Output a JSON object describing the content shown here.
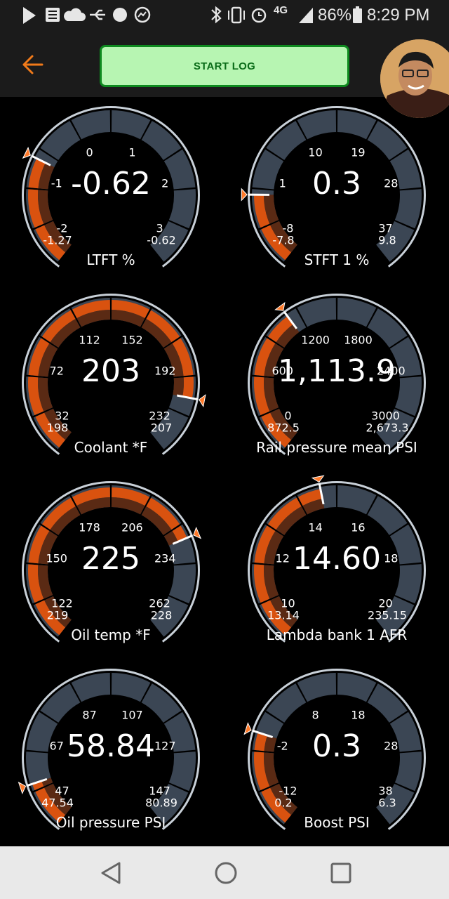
{
  "status_bar": {
    "battery": "86%",
    "time": "8:29 PM",
    "network": "4G",
    "icons": [
      "play-icon",
      "news-icon",
      "cloud-icon",
      "usb-icon",
      "baseball-icon",
      "messenger-icon",
      "bluetooth-icon",
      "vibrate-icon",
      "alarm-icon",
      "lte-icon",
      "signal-icon",
      "battery-icon"
    ]
  },
  "app_bar": {
    "back_icon": "arrow-left-icon",
    "start_log_label": "START LOG",
    "accent": "#f07a1a"
  },
  "colors": {
    "needle_fill": "#d9520f",
    "track": "#3b4654",
    "start_log_bg": "#b7f5b2",
    "start_log_border": "#0e8a1f"
  },
  "gauges": [
    {
      "title": "LTFT %",
      "value": "-0.62",
      "min_reading": "-1.27",
      "max_reading": "-0.62",
      "ticks": [
        "-2",
        "-1",
        "0",
        "1",
        "2",
        "3"
      ],
      "scale_min": -2,
      "scale_max": 3,
      "current": -0.62,
      "min": -1.27,
      "max": -0.62
    },
    {
      "title": "STFT 1 %",
      "value": "0.3",
      "min_reading": "-7.8",
      "max_reading": "9.8",
      "ticks": [
        "-8",
        "1",
        "10",
        "19",
        "28",
        "37"
      ],
      "scale_min": -8,
      "scale_max": 37,
      "current": 0.3,
      "min": -7.8,
      "max": 9.8
    },
    {
      "title": "Coolant *F",
      "value": "203",
      "min_reading": "198",
      "max_reading": "207",
      "ticks": [
        "32",
        "72",
        "112",
        "152",
        "192",
        "232"
      ],
      "scale_min": 32,
      "scale_max": 232,
      "current": 203,
      "min": 198,
      "max": 207
    },
    {
      "title": "Rail pressure mean PSI",
      "value": "1,113.9",
      "min_reading": "872.5",
      "max_reading": "2,673.3",
      "ticks": [
        "0",
        "600",
        "1200",
        "1800",
        "2400",
        "3000"
      ],
      "scale_min": 0,
      "scale_max": 3000,
      "current": 1113.9,
      "min": 872.5,
      "max": 2673.3
    },
    {
      "title": "Oil temp *F",
      "value": "225",
      "min_reading": "219",
      "max_reading": "228",
      "ticks": [
        "122",
        "150",
        "178",
        "206",
        "234",
        "262"
      ],
      "scale_min": 122,
      "scale_max": 262,
      "current": 225,
      "min": 219,
      "max": 228
    },
    {
      "title": "Lambda bank 1 AFR",
      "value": "14.60",
      "min_reading": "13.14",
      "max_reading": "235.15",
      "ticks": [
        "10",
        "12",
        "14",
        "16",
        "18",
        "20"
      ],
      "scale_min": 10,
      "scale_max": 20,
      "current": 14.6,
      "min": 13.14,
      "max": 235.15
    },
    {
      "title": "Oil pressure PSI",
      "value": "58.84",
      "min_reading": "47.54",
      "max_reading": "80.89",
      "ticks": [
        "47",
        "67",
        "87",
        "107",
        "127",
        "147"
      ],
      "scale_min": 47,
      "scale_max": 147,
      "current": 58.84,
      "min": 47.54,
      "max": 80.89
    },
    {
      "title": "Boost PSI",
      "value": "0.3",
      "min_reading": "0.2",
      "max_reading": "6.3",
      "ticks": [
        "-12",
        "-2",
        "8",
        "18",
        "28",
        "38"
      ],
      "scale_min": -12,
      "scale_max": 38,
      "current": 0.3,
      "min": 0.2,
      "max": 6.3
    }
  ],
  "nav_bar": {
    "icons": [
      "back-triangle-icon",
      "home-circle-icon",
      "recents-square-icon"
    ]
  }
}
